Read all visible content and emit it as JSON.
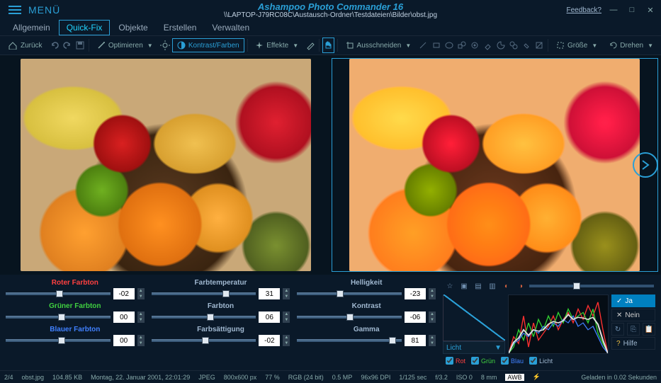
{
  "titlebar": {
    "menu": "MENÜ",
    "appTitle": "Ashampoo Photo Commander 16",
    "path": "\\\\LAPTOP-J79RC08C\\Austausch-Ordner\\Testdateien\\Bilder\\obst.jpg",
    "feedback": "Feedback?"
  },
  "tabs": {
    "items": [
      "Allgemein",
      "Quick-Fix",
      "Objekte",
      "Erstellen",
      "Verwalten"
    ],
    "active": 1
  },
  "toolbar": {
    "back": "Zurück",
    "optimize": "Optimieren",
    "contrast": "Kontrast/Farben",
    "effects": "Effekte",
    "cut": "Ausschneiden",
    "size": "Größe",
    "rotate": "Drehen"
  },
  "sliders": {
    "col1": [
      {
        "label": "Roter Farbton",
        "color": "red",
        "value": "-02"
      },
      {
        "label": "Grüner Farbton",
        "color": "green",
        "value": "00"
      },
      {
        "label": "Blauer Farbton",
        "color": "blue",
        "value": "00"
      }
    ],
    "col2": [
      {
        "label": "Farbtemperatur",
        "color": "",
        "value": "31"
      },
      {
        "label": "Farbton",
        "color": "",
        "value": "06"
      },
      {
        "label": "Farbsättigung",
        "color": "",
        "value": "-02"
      }
    ],
    "col3": [
      {
        "label": "Helligkeit",
        "color": "",
        "value": "-23"
      },
      {
        "label": "Kontrast",
        "color": "",
        "value": "-06"
      },
      {
        "label": "Gamma",
        "color": "",
        "value": "81"
      }
    ]
  },
  "histogram": {
    "select": "Licht",
    "checks": {
      "rot": "Rot",
      "grun": "Grün",
      "blau": "Blau",
      "licht": "Licht"
    }
  },
  "sidebuttons": {
    "ja": "Ja",
    "nein": "Nein",
    "hilfe": "Hilfe"
  },
  "statusbar": {
    "index": "2/4",
    "filename": "obst.jpg",
    "filesize": "104.85 KB",
    "date": "Montag, 22. Januar 2001, 22:01:29",
    "format": "JPEG",
    "dims": "800x600 px",
    "zoom": "77 %",
    "colordepth": "RGB (24 bit)",
    "mp": "0.5 MP",
    "dpi": "96x96 DPI",
    "shutter": "1/125 sec",
    "aperture": "f/3.2",
    "iso": "ISO 0",
    "focal": "8 mm",
    "awb": "AWB",
    "flash": "⚡",
    "loadtime": "Geladen in 0.02 Sekunden"
  }
}
